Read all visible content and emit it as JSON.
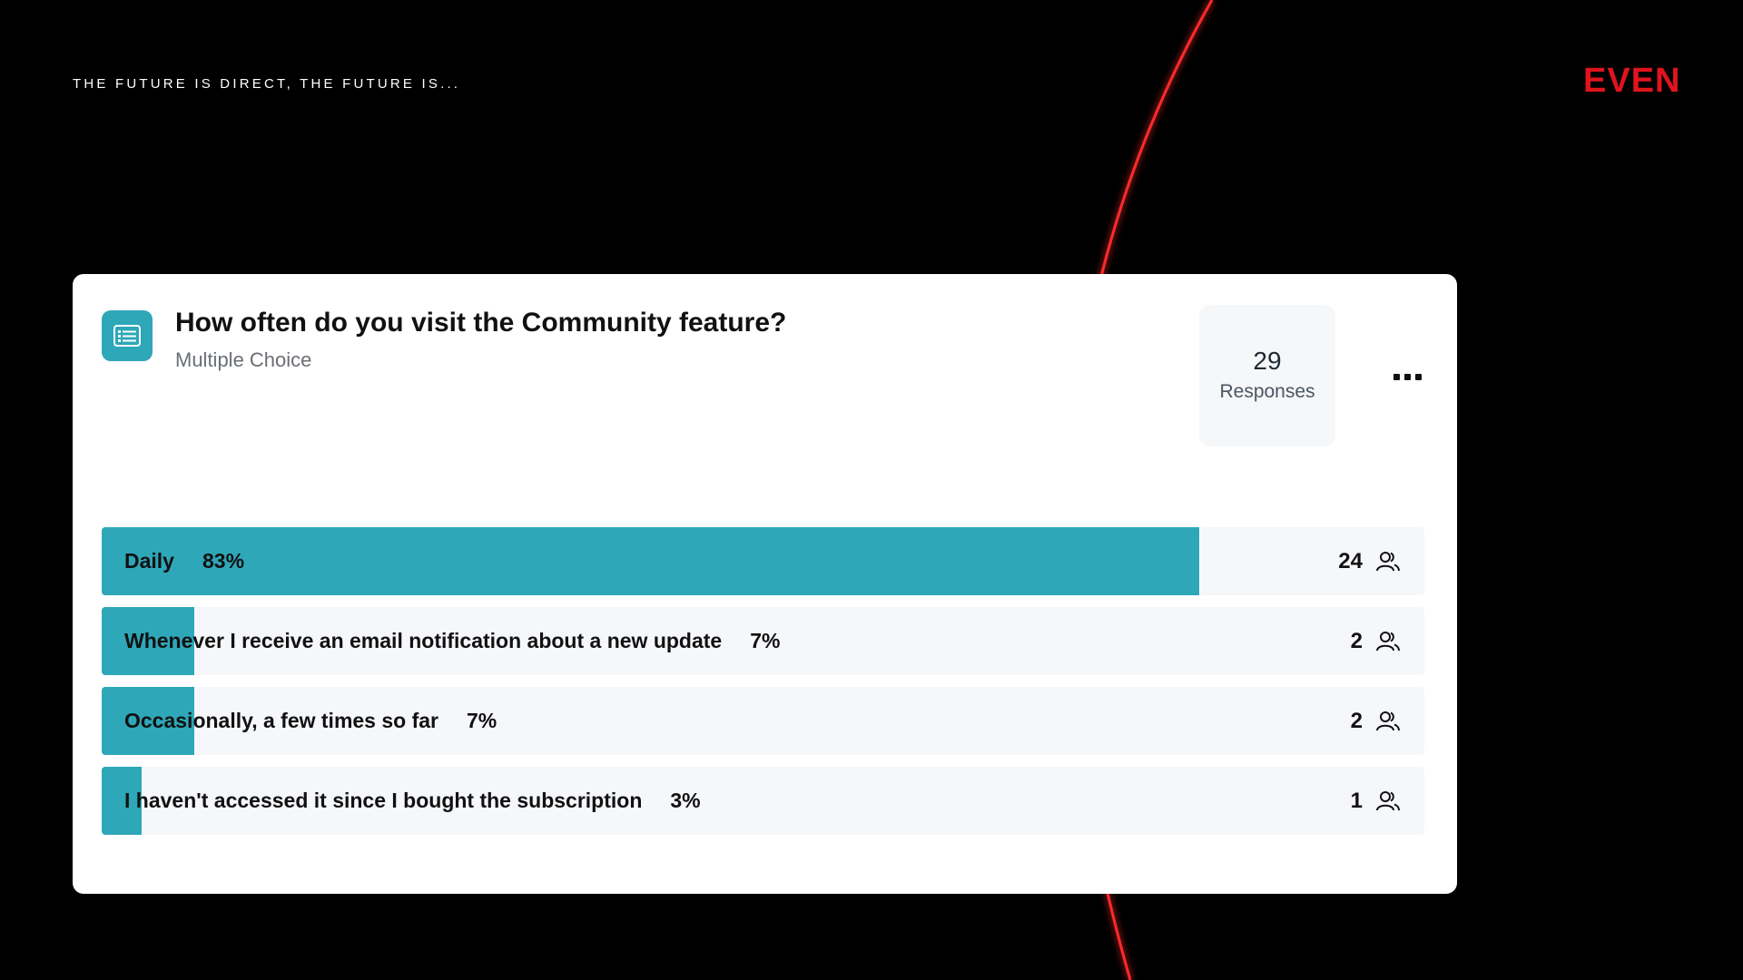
{
  "header": {
    "tagline": "THE FUTURE IS DIRECT, THE FUTURE IS...",
    "brand": "EVEN"
  },
  "colors": {
    "accent": "#2ea7b9",
    "brand": "#e0141e",
    "arc": "#ff2a2a",
    "background": "#000000"
  },
  "question": {
    "icon": "list-icon",
    "title": "How often do you visit the Community feature?",
    "type": "Multiple Choice",
    "responses_count": "29",
    "responses_label": "Responses",
    "more_icon": "more-options-icon"
  },
  "options": [
    {
      "label": "Daily",
      "percent": "83%",
      "fraction": 0.83,
      "count": "24"
    },
    {
      "label": "Whenever I receive an email notification about a new update",
      "percent": "7%",
      "fraction": 0.07,
      "count": "2"
    },
    {
      "label": "Occasionally, a few times so far",
      "percent": "7%",
      "fraction": 0.07,
      "count": "2"
    },
    {
      "label": "I haven't accessed it since I bought the subscription",
      "percent": "3%",
      "fraction": 0.03,
      "count": "1"
    }
  ]
}
